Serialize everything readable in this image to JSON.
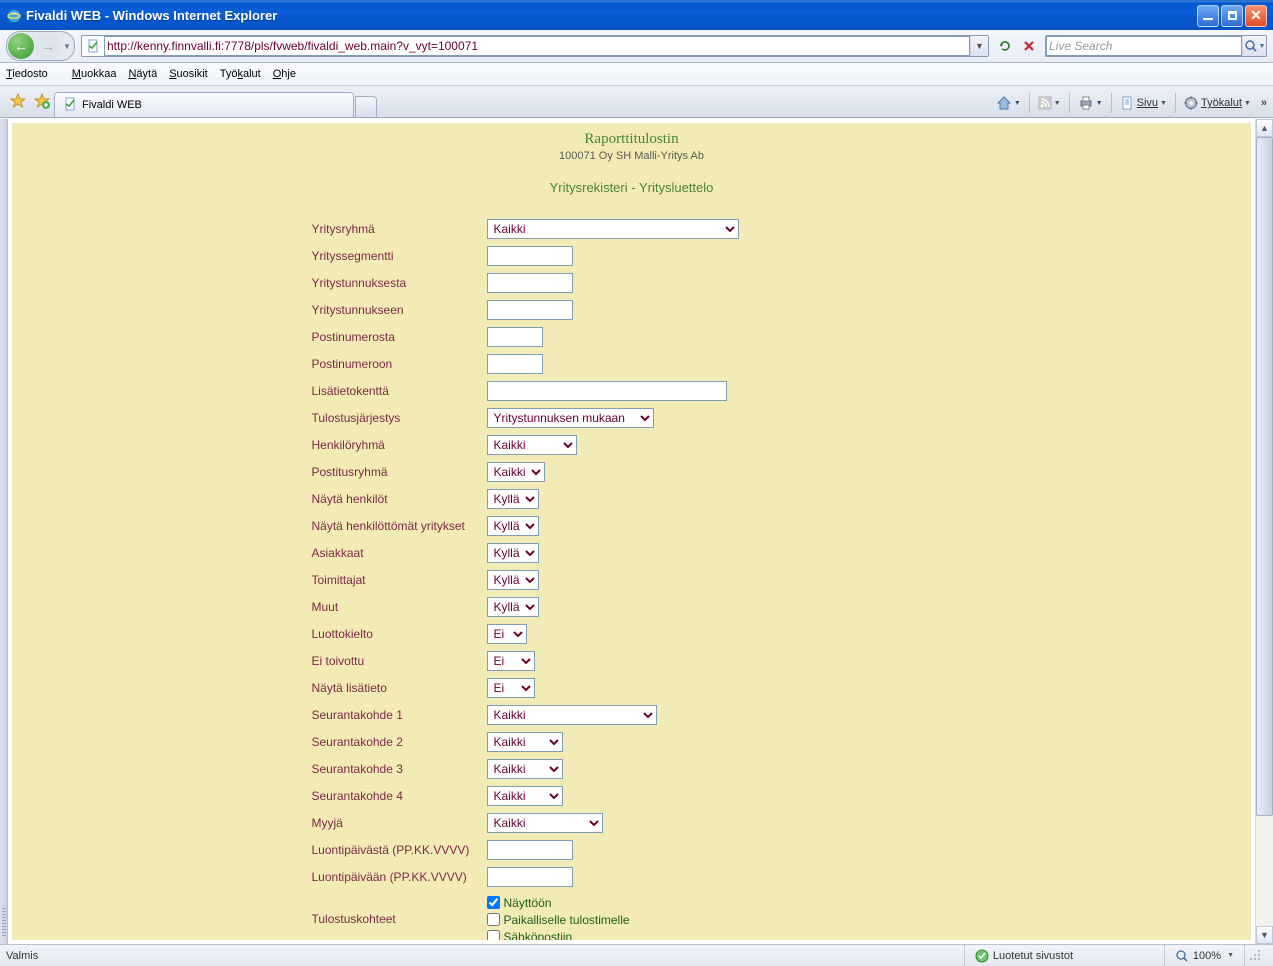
{
  "window": {
    "title": "Fivaldi WEB - Windows Internet Explorer"
  },
  "nav": {
    "url": "http://kenny.finnvalli.fi:7778/pls/fvweb/fivaldi_web.main?v_vyt=100071",
    "search_placeholder": "Live Search"
  },
  "menubar": [
    "Tiedosto",
    "Muokkaa",
    "Näytä",
    "Suosikit",
    "Työkalut",
    "Ohje"
  ],
  "tab": {
    "title": "Fivaldi WEB"
  },
  "cmdbar": {
    "sivu": "Sivu",
    "tyokalut": "Työkalut"
  },
  "page": {
    "title": "Raporttitulostin",
    "subtitle": "100071 Oy SH Malli-Yritys Ab",
    "section": "Yritysrekisteri - Yritysluettelo"
  },
  "form": {
    "yritysryhma_label": "Yritysryhmä",
    "yritysryhma_value": "Kaikki",
    "yrityssegmentti_label": "Yrityssegmentti",
    "yritystunnuksesta_label": "Yritystunnuksesta",
    "yritystunnukseen_label": "Yritystunnukseen",
    "postinumerosta_label": "Postinumerosta",
    "postinumeroon_label": "Postinumeroon",
    "lisatietokentta_label": "Lisätietokenttä",
    "tulostusjarjestys_label": "Tulostusjärjestys",
    "tulostusjarjestys_value": "Yritystunnuksen mukaan",
    "henkiloryhma_label": "Henkilöryhmä",
    "henkiloryhma_value": "Kaikki",
    "postitusryhma_label": "Postitusryhmä",
    "postitusryhma_value": "Kaikki",
    "nayta_henkilot_label": "Näytä henkilöt",
    "nayta_henkilot_value": "Kyllä",
    "nayta_henkilottomat_label": "Näytä henkilöttömät yritykset",
    "nayta_henkilottomat_value": "Kyllä",
    "asiakkaat_label": "Asiakkaat",
    "asiakkaat_value": "Kyllä",
    "toimittajat_label": "Toimittajat",
    "toimittajat_value": "Kyllä",
    "muut_label": "Muut",
    "muut_value": "Kyllä",
    "luottokielto_label": "Luottokielto",
    "luottokielto_value": "Ei",
    "ei_toivottu_label": "Ei toivottu",
    "ei_toivottu_value": "Ei",
    "nayta_lisatieto_label": "Näytä lisätieto",
    "nayta_lisatieto_value": "Ei",
    "seurantakohde1_label": "Seurantakohde 1",
    "seurantakohde1_value": "Kaikki",
    "seurantakohde2_label": "Seurantakohde 2",
    "seurantakohde2_value": "Kaikki",
    "seurantakohde3_label": "Seurantakohde 3",
    "seurantakohde3_value": "Kaikki",
    "seurantakohde4_label": "Seurantakohde 4",
    "seurantakohde4_value": "Kaikki",
    "myyja_label": "Myyjä",
    "myyja_value": "Kaikki",
    "luontipaivasta_label": "Luontipäivästä (PP.KK.VVVV)",
    "luontipaivaan_label": "Luontipäivään (PP.KK.VVVV)",
    "tulostuskohteet_label": "Tulostuskohteet",
    "chk_nayttoon": "Näyttöön",
    "chk_paikalliselle": "Paikalliselle tulostimelle",
    "chk_sahkopostiin": "Sähköpostiin"
  },
  "statusbar": {
    "status": "Valmis",
    "zone": "Luotetut sivustot",
    "zoom": "100%"
  }
}
